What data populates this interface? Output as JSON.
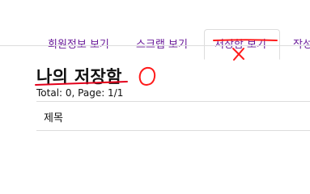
{
  "tabs": [
    {
      "label": "회원정보 보기"
    },
    {
      "label": "스크랩 보기"
    },
    {
      "label": "저장함 보기",
      "active": true
    },
    {
      "label": "작성"
    }
  ],
  "page": {
    "title": "나의 저장함",
    "summary": "Total: 0, Page: 1/1"
  },
  "table": {
    "columns": [
      "제목"
    ]
  },
  "annotations": {
    "mark_under_tab": "X",
    "mark_next_to_title": "O",
    "color": "#ff0000"
  },
  "colors": {
    "tab_text": "#6a1b9a",
    "border": "#dddddd"
  }
}
